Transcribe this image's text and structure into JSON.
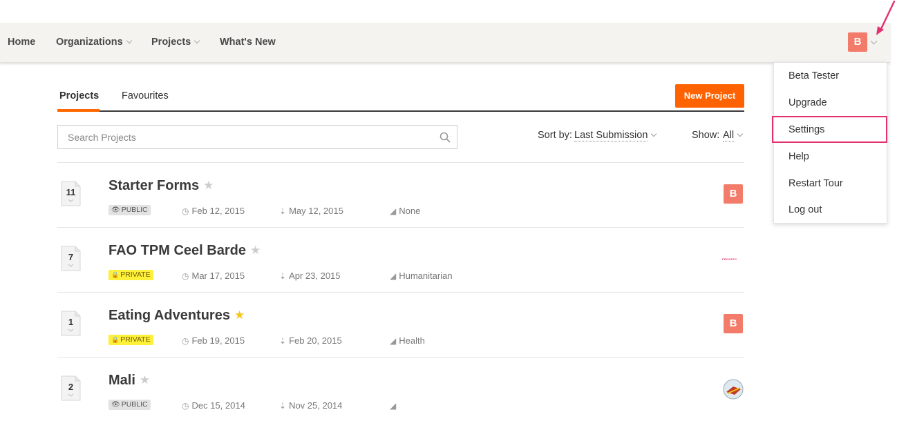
{
  "nav": {
    "home": "Home",
    "organizations": "Organizations",
    "projects": "Projects",
    "whats_new": "What's New",
    "avatar_initial": "B"
  },
  "user_menu": {
    "items": [
      {
        "label": "Beta Tester"
      },
      {
        "label": "Upgrade"
      },
      {
        "label": "Settings",
        "highlighted": true
      },
      {
        "label": "Help"
      },
      {
        "label": "Restart Tour"
      },
      {
        "label": "Log out"
      }
    ]
  },
  "tabs": [
    {
      "label": "Projects",
      "active": true
    },
    {
      "label": "Favourites",
      "active": false
    }
  ],
  "new_project_label": "New Project",
  "search": {
    "placeholder": "Search Projects"
  },
  "sort": {
    "label": "Sort by:",
    "value": "Last Submission"
  },
  "show": {
    "label": "Show:",
    "value": "All"
  },
  "projects": [
    {
      "count": "11",
      "title": "Starter Forms",
      "favourite": false,
      "visibility": "PUBLIC",
      "created": "Feb 12, 2015",
      "last_submission": "May 12, 2015",
      "tag": "None",
      "owner": {
        "type": "initial",
        "value": "B"
      }
    },
    {
      "count": "7",
      "title": "FAO TPM Ceel Barde",
      "favourite": false,
      "visibility": "PRIVATE",
      "created": "Mar 17, 2015",
      "last_submission": "Apr 23, 2015",
      "tag": "Humanitarian",
      "owner": {
        "type": "logo",
        "value": "FRONTEC"
      }
    },
    {
      "count": "1",
      "title": "Eating Adventures",
      "favourite": true,
      "visibility": "PRIVATE",
      "created": "Feb 19, 2015",
      "last_submission": "Feb 20, 2015",
      "tag": "Health",
      "owner": {
        "type": "initial",
        "value": "B"
      }
    },
    {
      "count": "2",
      "title": "Mali",
      "favourite": false,
      "visibility": "PUBLIC",
      "created": "Dec 15, 2014",
      "last_submission": "Nov 25, 2014",
      "tag": "",
      "owner": {
        "type": "image",
        "value": ""
      }
    }
  ],
  "colors": {
    "accent": "#ff6200",
    "avatar": "#f37b6a",
    "highlight": "#e3326f",
    "private_badge": "#fff03a",
    "public_badge": "#e2e2e2",
    "star_active": "#f5c518",
    "star_inactive": "#cccccc"
  },
  "icons": {
    "visibility_public": "eye-icon",
    "visibility_private": "lock-icon",
    "created": "clock-icon",
    "last_submission": "download-icon",
    "tag": "tag-icon",
    "search": "search-icon",
    "favourite": "star-icon"
  }
}
